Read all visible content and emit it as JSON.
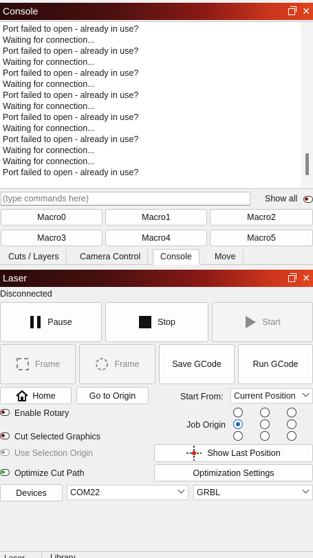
{
  "console": {
    "title": "Console",
    "lines": [
      "Port failed to open - already in use?",
      "Waiting for connection...",
      "Port failed to open - already in use?",
      "Waiting for connection...",
      "Port failed to open - already in use?",
      "Waiting for connection...",
      "Port failed to open - already in use?",
      "Waiting for connection...",
      "Port failed to open - already in use?",
      "Waiting for connection...",
      "Port failed to open - already in use?",
      "Waiting for connection...",
      "Waiting for connection...",
      "Port failed to open - already in use?"
    ],
    "command_placeholder": "(type commands here)",
    "command_value": "",
    "show_all_label": "Show all",
    "macros": [
      "Macro0",
      "Macro1",
      "Macro2",
      "Macro3",
      "Macro4",
      "Macro5"
    ]
  },
  "tabs": [
    {
      "label": "Cuts / Layers",
      "active": false
    },
    {
      "label": "Camera Control",
      "active": false
    },
    {
      "label": "Console",
      "active": true
    },
    {
      "label": "Move",
      "active": false
    }
  ],
  "laser": {
    "title": "Laser",
    "status": "Disconnected",
    "pause_label": "Pause",
    "stop_label": "Stop",
    "start_label": "Start",
    "frame_label": "Frame",
    "frame2_label": "Frame",
    "save_gcode_label": "Save GCode",
    "run_gcode_label": "Run GCode",
    "home_label": "Home",
    "go_to_origin_label": "Go to Origin",
    "start_from_label": "Start From:",
    "start_from_value": "Current Position",
    "enable_rotary_label": "Enable Rotary",
    "job_origin_label": "Job Origin",
    "cut_selected_label": "Cut Selected Graphics",
    "use_selection_origin_label": "Use Selection Origin",
    "show_last_position_label": "Show Last Position",
    "optimize_cut_path_label": "Optimize Cut Path",
    "optimization_settings_label": "Optimization Settings",
    "devices_label": "Devices",
    "port_value": "COM22",
    "controller_value": "GRBL",
    "job_origin_selected": 3
  },
  "bottom_tabs": [
    "Laser",
    "Library"
  ],
  "colors": {
    "accent_red": "#8a1010",
    "toggle_on": "#1db31d",
    "radio_selected": "#1565c0"
  }
}
